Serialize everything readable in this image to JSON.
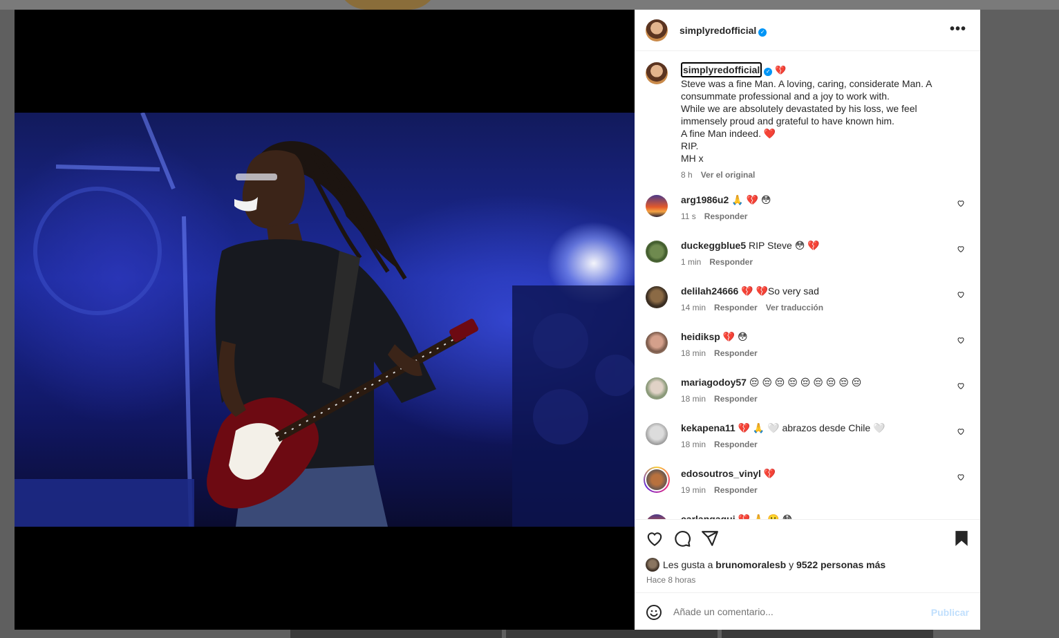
{
  "post": {
    "username": "simplyredofficial",
    "more_label": "•••"
  },
  "caption": {
    "username": "simplyredofficial",
    "lines": [
      "Steve was a fine Man. A loving, caring, considerate Man. A consummate professional and a joy to work with.",
      "While we are absolutely devastated by his loss, we feel immensely proud and grateful to have known him.",
      "A fine Man indeed. ❤️",
      "RIP.",
      "MH x"
    ],
    "head_emoji": "💔",
    "time": "8 h",
    "see_original": "Ver el original"
  },
  "comments": [
    {
      "user": "arg1986u2",
      "text": "🙏 💔 😳",
      "time": "11 s",
      "reply": "Responder"
    },
    {
      "user": "duckeggblue5",
      "text": "RIP Steve 😳 💔",
      "time": "1 min",
      "reply": "Responder"
    },
    {
      "user": "delilah24666",
      "text": "💔 💔So very sad",
      "time": "14 min",
      "reply": "Responder",
      "translate": "Ver traducción"
    },
    {
      "user": "heidiksp",
      "text": "💔 😳",
      "time": "18 min",
      "reply": "Responder"
    },
    {
      "user": "mariagodoy57",
      "text": "😔 😔 😔 😔 😔 😔 😔 😔 😔",
      "time": "18 min",
      "reply": "Responder"
    },
    {
      "user": "kekapena11",
      "text": "💔 🙏 🤍 abrazos desde Chile 🤍",
      "time": "18 min",
      "reply": "Responder"
    },
    {
      "user": "edosoutros_vinyl",
      "text": "💔",
      "time": "19 min",
      "reply": "Responder"
    },
    {
      "user": "carlangagui",
      "text": "💔 🙏 🙁 😳",
      "time": "",
      "reply": ""
    }
  ],
  "likes": {
    "prefix": "Les gusta a",
    "first_user": "brunomoralesb",
    "conj": "y",
    "others": "9522 personas más"
  },
  "time_ago": "Hace 8 horas",
  "composer": {
    "placeholder": "Añade un comentario...",
    "post_label": "Publicar"
  },
  "icons": [
    "more-icon",
    "verified-badge-icon",
    "heart-icon",
    "comment-icon",
    "share-icon",
    "bookmark-icon",
    "smile-icon"
  ],
  "colors": {
    "verified": "#0095f6",
    "heart": "#e0245e",
    "muted": "#737373",
    "post_disabled": "#c0dffd"
  }
}
